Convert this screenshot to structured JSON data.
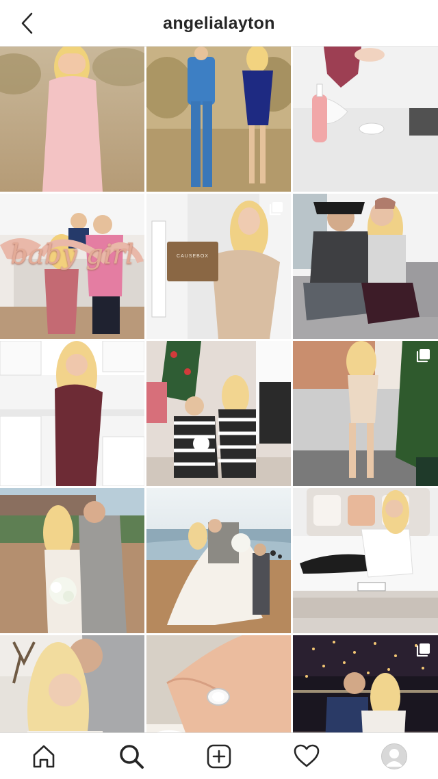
{
  "header": {
    "title": "angelialayton",
    "back_icon": "chevron-left-icon"
  },
  "colors": {
    "text": "#262626",
    "divider": "#dbdbdb",
    "background": "#ffffff"
  },
  "grid": {
    "columns": 3,
    "posts": [
      {
        "id": "post-1",
        "icon": "none"
      },
      {
        "id": "post-2",
        "icon": "none"
      },
      {
        "id": "post-3",
        "icon": "none"
      },
      {
        "id": "post-4",
        "icon": "none"
      },
      {
        "id": "post-5",
        "icon": "multiple-photos-icon"
      },
      {
        "id": "post-6",
        "icon": "none"
      },
      {
        "id": "post-7",
        "icon": "none"
      },
      {
        "id": "post-8",
        "icon": "none"
      },
      {
        "id": "post-9",
        "icon": "multiple-photos-icon"
      },
      {
        "id": "post-10",
        "icon": "none"
      },
      {
        "id": "post-11",
        "icon": "none"
      },
      {
        "id": "post-12",
        "icon": "none"
      },
      {
        "id": "post-13",
        "icon": "none"
      },
      {
        "id": "post-14",
        "icon": "none"
      },
      {
        "id": "post-15",
        "icon": "multiple-photos-icon"
      }
    ],
    "overlay_text": {
      "post-4": "baby girl",
      "post-5": "CAUSEBOX"
    }
  },
  "tabbar": {
    "items": [
      {
        "name": "home",
        "icon": "home-icon",
        "active": false
      },
      {
        "name": "search",
        "icon": "search-icon",
        "active": true
      },
      {
        "name": "new-post",
        "icon": "plus-square-icon",
        "active": false
      },
      {
        "name": "activity",
        "icon": "heart-icon",
        "active": false
      },
      {
        "name": "profile",
        "icon": "avatar-icon",
        "active": false
      }
    ]
  }
}
